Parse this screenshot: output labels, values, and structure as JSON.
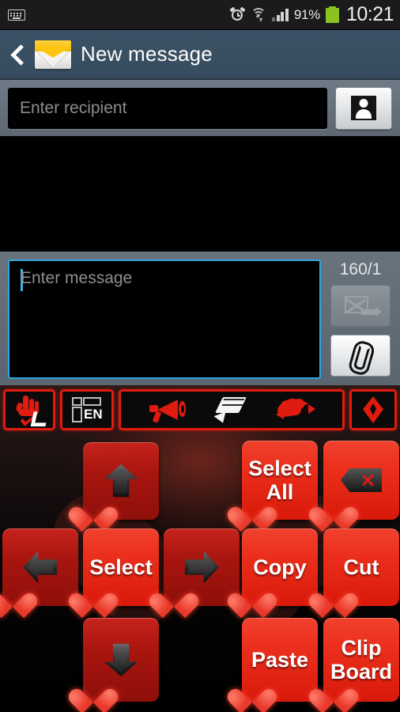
{
  "statusbar": {
    "icons": [
      "keyboard-icon",
      "alarm-icon",
      "wifi-icon",
      "signal-icon"
    ],
    "battery_percent": "91%",
    "time": "10:21"
  },
  "actionbar": {
    "back_label": "back",
    "app_icon": "envelope-icon",
    "title": "New message"
  },
  "recipient": {
    "placeholder": "Enter recipient",
    "value": "",
    "contacts_button": "contacts-icon"
  },
  "composer": {
    "placeholder": "Enter message",
    "value": "",
    "counter": "160/1",
    "send_button": "send-icon",
    "attach_button": "paperclip-icon"
  },
  "keyboard": {
    "toolbar": [
      {
        "name": "hand-swipe-icon",
        "label": ""
      },
      {
        "name": "keyboard-layout-icon",
        "label": "EN"
      },
      {
        "name": "megaphone-icon",
        "label": ""
      },
      {
        "name": "pen-icon",
        "label": ""
      },
      {
        "name": "bird-icon",
        "label": ""
      },
      {
        "name": "diamond-arrow-icon",
        "label": ""
      }
    ],
    "keys": [
      {
        "id": "arrow-up",
        "label": "",
        "icon": "arrow-up-icon",
        "style": "dark"
      },
      {
        "id": "select-all",
        "label": "Select\nAll",
        "icon": "",
        "style": "bright"
      },
      {
        "id": "backspace",
        "label": "",
        "icon": "backspace-icon",
        "style": "bright"
      },
      {
        "id": "arrow-left",
        "label": "",
        "icon": "arrow-left-icon",
        "style": "dark"
      },
      {
        "id": "select",
        "label": "Select",
        "icon": "",
        "style": "bright"
      },
      {
        "id": "arrow-right",
        "label": "",
        "icon": "arrow-right-icon",
        "style": "dark"
      },
      {
        "id": "copy",
        "label": "Copy",
        "icon": "",
        "style": "bright"
      },
      {
        "id": "cut",
        "label": "Cut",
        "icon": "",
        "style": "bright"
      },
      {
        "id": "arrow-down",
        "label": "",
        "icon": "arrow-down-icon",
        "style": "dark"
      },
      {
        "id": "paste",
        "label": "Paste",
        "icon": "",
        "style": "bright"
      },
      {
        "id": "clipboard",
        "label": "Clip\nBoard",
        "icon": "",
        "style": "bright"
      }
    ],
    "labels": {
      "select_all_line1": "Select",
      "select_all_line2": "All",
      "select": "Select",
      "copy": "Copy",
      "cut": "Cut",
      "paste": "Paste",
      "clipboard_line1": "Clip",
      "clipboard_line2": "Board",
      "en": "EN"
    }
  },
  "colors": {
    "accent_red": "#e01b0f",
    "key_bright": "#ec2f1c",
    "key_dark": "#a8150f",
    "actionbar": "#3b5266",
    "composer_bar": "#68737d",
    "focus_blue": "#2ea7e0",
    "battery_green": "#8bc220"
  }
}
